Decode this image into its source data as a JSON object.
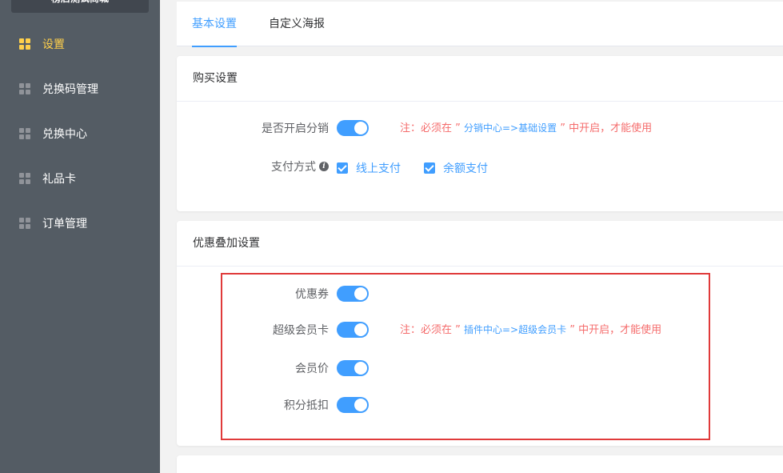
{
  "sidebar": {
    "brand": "榜店测试商城",
    "items": [
      {
        "label": "设置",
        "active": true
      },
      {
        "label": "兑换码管理",
        "active": false
      },
      {
        "label": "兑换中心",
        "active": false
      },
      {
        "label": "礼品卡",
        "active": false
      },
      {
        "label": "订单管理",
        "active": false
      }
    ]
  },
  "tabs": [
    {
      "label": "基本设置",
      "active": true
    },
    {
      "label": "自定义海报",
      "active": false
    }
  ],
  "purchase": {
    "title": "购买设置",
    "distribution_label": "是否开启分销",
    "distribution_on": true,
    "note_prefix": "注：必须在 ” ",
    "note_link": "分销中心=>基础设置",
    "note_suffix": " ” 中开启，才能使用",
    "payment_label": "支付方式",
    "payment_options": [
      {
        "label": "线上支付",
        "checked": true
      },
      {
        "label": "余额支付",
        "checked": true
      }
    ]
  },
  "discount": {
    "title": "优惠叠加设置",
    "rows": [
      {
        "label": "优惠券",
        "on": true
      },
      {
        "label": "超级会员卡",
        "on": true
      },
      {
        "label": "会员价",
        "on": true
      },
      {
        "label": "积分抵扣",
        "on": true
      }
    ],
    "note_prefix": "注：必须在 ” ",
    "note_link": "插件中心=>超级会员卡",
    "note_suffix": " ” 中开启，才能使用"
  },
  "colors": {
    "accent": "#409eff",
    "active_menu": "#ffd04b",
    "warning": "#f56c6c",
    "highlight_border": "#e03a3a"
  }
}
